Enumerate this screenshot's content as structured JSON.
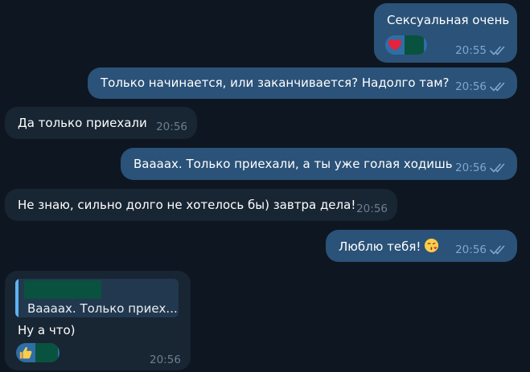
{
  "colors": {
    "background": "#0e1621",
    "outgoing_bubble": "#2b5278",
    "incoming_bubble": "#182533",
    "outgoing_meta": "#7da8d3",
    "incoming_meta": "#6d7f8f",
    "reply_accent": "#5fb3f1",
    "redaction": "#09523f"
  },
  "messages": [
    {
      "direction": "out",
      "text": "Сексуальная очень",
      "time": "20:55",
      "status_icon": "double-check-icon",
      "reaction": "heart-icon"
    },
    {
      "direction": "out",
      "text": "Только начинается, или заканчивается? Надолго там?",
      "time": "20:56",
      "status_icon": "double-check-icon"
    },
    {
      "direction": "in",
      "text": "Да только приехали",
      "time": "20:56"
    },
    {
      "direction": "out",
      "text": "Ваааах. Только приехали, а ты уже голая ходишь",
      "time": "20:56",
      "status_icon": "double-check-icon"
    },
    {
      "direction": "in",
      "text": "Не знаю, сильно долго не хотелось бы) завтра дела!",
      "time": "20:56"
    },
    {
      "direction": "out",
      "text": "Люблю тебя!",
      "time": "20:56",
      "status_icon": "double-check-icon",
      "emoji": "kissing-face-icon"
    },
    {
      "direction": "in",
      "reply_quote": "Ваааах. Только приех...",
      "text": "Ну а что)",
      "time": "20:56",
      "reaction": "thumbs-up-icon"
    }
  ]
}
